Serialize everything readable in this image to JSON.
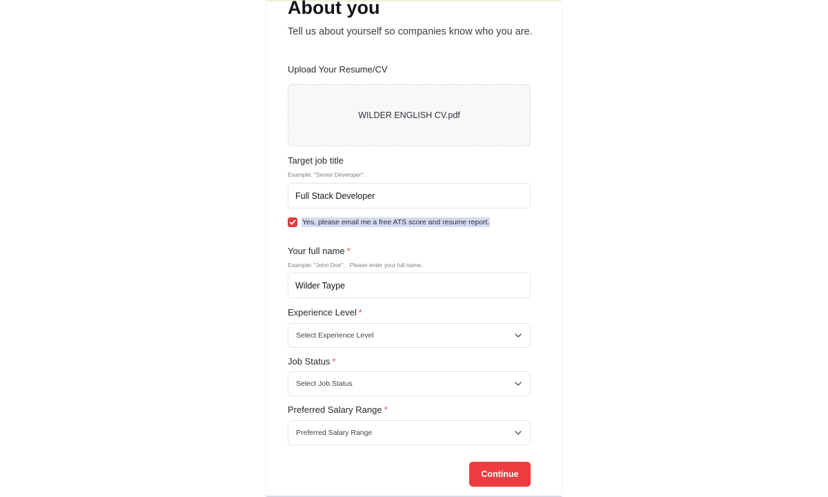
{
  "header": {
    "title": "About you",
    "subtitle": "Tell us about yourself so companies know who you are."
  },
  "resume": {
    "label": "Upload Your Resume/CV",
    "file_name": "WILDER ENGLISH CV.pdf"
  },
  "job_title": {
    "label": "Target job title",
    "hint": "Example: \"Senior Developer\".",
    "value": "Full Stack Developer"
  },
  "ats_opt_in": {
    "checked": true,
    "label": "Yes, please email me a free ATS score and resume report."
  },
  "full_name": {
    "label": "Your full name",
    "required_mark": "*",
    "hint": "Example: \"John Doe\".   Please enter your full name.",
    "value": "Wilder Taype"
  },
  "experience": {
    "label": "Experience Level",
    "required_mark": "*",
    "selected": "Select Experience Level"
  },
  "job_status": {
    "label": "Job Status",
    "required_mark": "*",
    "selected": "Select Job Status"
  },
  "salary": {
    "label": "Preferred Salary Range",
    "required_mark": "*",
    "selected": "Preferred Salary Range"
  },
  "actions": {
    "continue_label": "Continue"
  },
  "colors": {
    "accent": "#ef3b40",
    "required": "#e5484d",
    "selection_highlight": "#d5dcef"
  },
  "icons": {
    "checkbox": "check-icon",
    "dropdown": "chevron-down-icon"
  }
}
